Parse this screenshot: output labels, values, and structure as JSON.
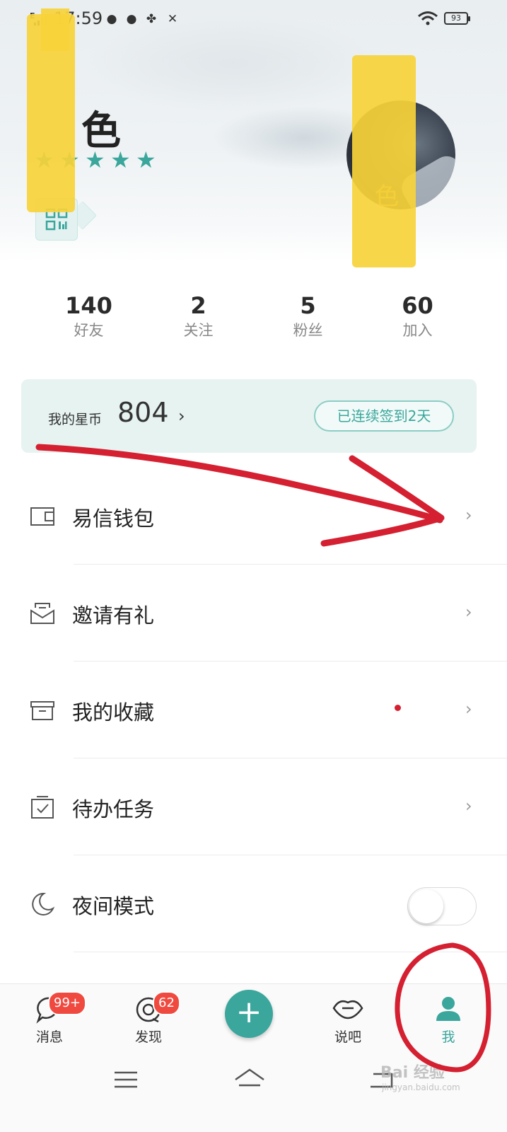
{
  "status_bar": {
    "signal_label": "E",
    "time": "17:59",
    "battery": "93"
  },
  "profile": {
    "nickname": "色",
    "avatar_caption": "色",
    "star_count": 5,
    "qr_icon": "qr-code-icon"
  },
  "stats": [
    {
      "value": "140",
      "label": "好友"
    },
    {
      "value": "2",
      "label": "关注"
    },
    {
      "value": "5",
      "label": "粉丝"
    },
    {
      "value": "60",
      "label": "加入"
    }
  ],
  "coins": {
    "label": "我的星币",
    "value": "804",
    "chevron": "›",
    "checkin_label": "已连续签到2天"
  },
  "menu": [
    {
      "label": "易信钱包",
      "icon": "wallet-icon",
      "arrow": "›"
    },
    {
      "label": "邀请有礼",
      "icon": "envelope-icon",
      "arrow": "›"
    },
    {
      "label": "我的收藏",
      "icon": "archive-box-icon",
      "arrow": "›"
    },
    {
      "label": "待办任务",
      "icon": "checklist-icon",
      "arrow": "›"
    },
    {
      "label": "夜间模式",
      "icon": "moon-icon",
      "toggle": false
    }
  ],
  "tabs": [
    {
      "label": "消息",
      "badge": "99+",
      "icon": "chat-bubble-icon"
    },
    {
      "label": "发现",
      "badge": "62",
      "icon": "discover-icon"
    },
    {
      "label": "",
      "icon": "plus-icon"
    },
    {
      "label": "说吧",
      "icon": "lips-icon"
    },
    {
      "label": "我",
      "icon": "person-icon",
      "active": true
    }
  ],
  "watermark": {
    "text": "Bai 经验",
    "sub": "jingyan.baidu.com"
  },
  "colors": {
    "accent": "#3aa69c",
    "badge": "#f04a40",
    "annotation": "#d42030",
    "redaction": "#f7d23a"
  }
}
